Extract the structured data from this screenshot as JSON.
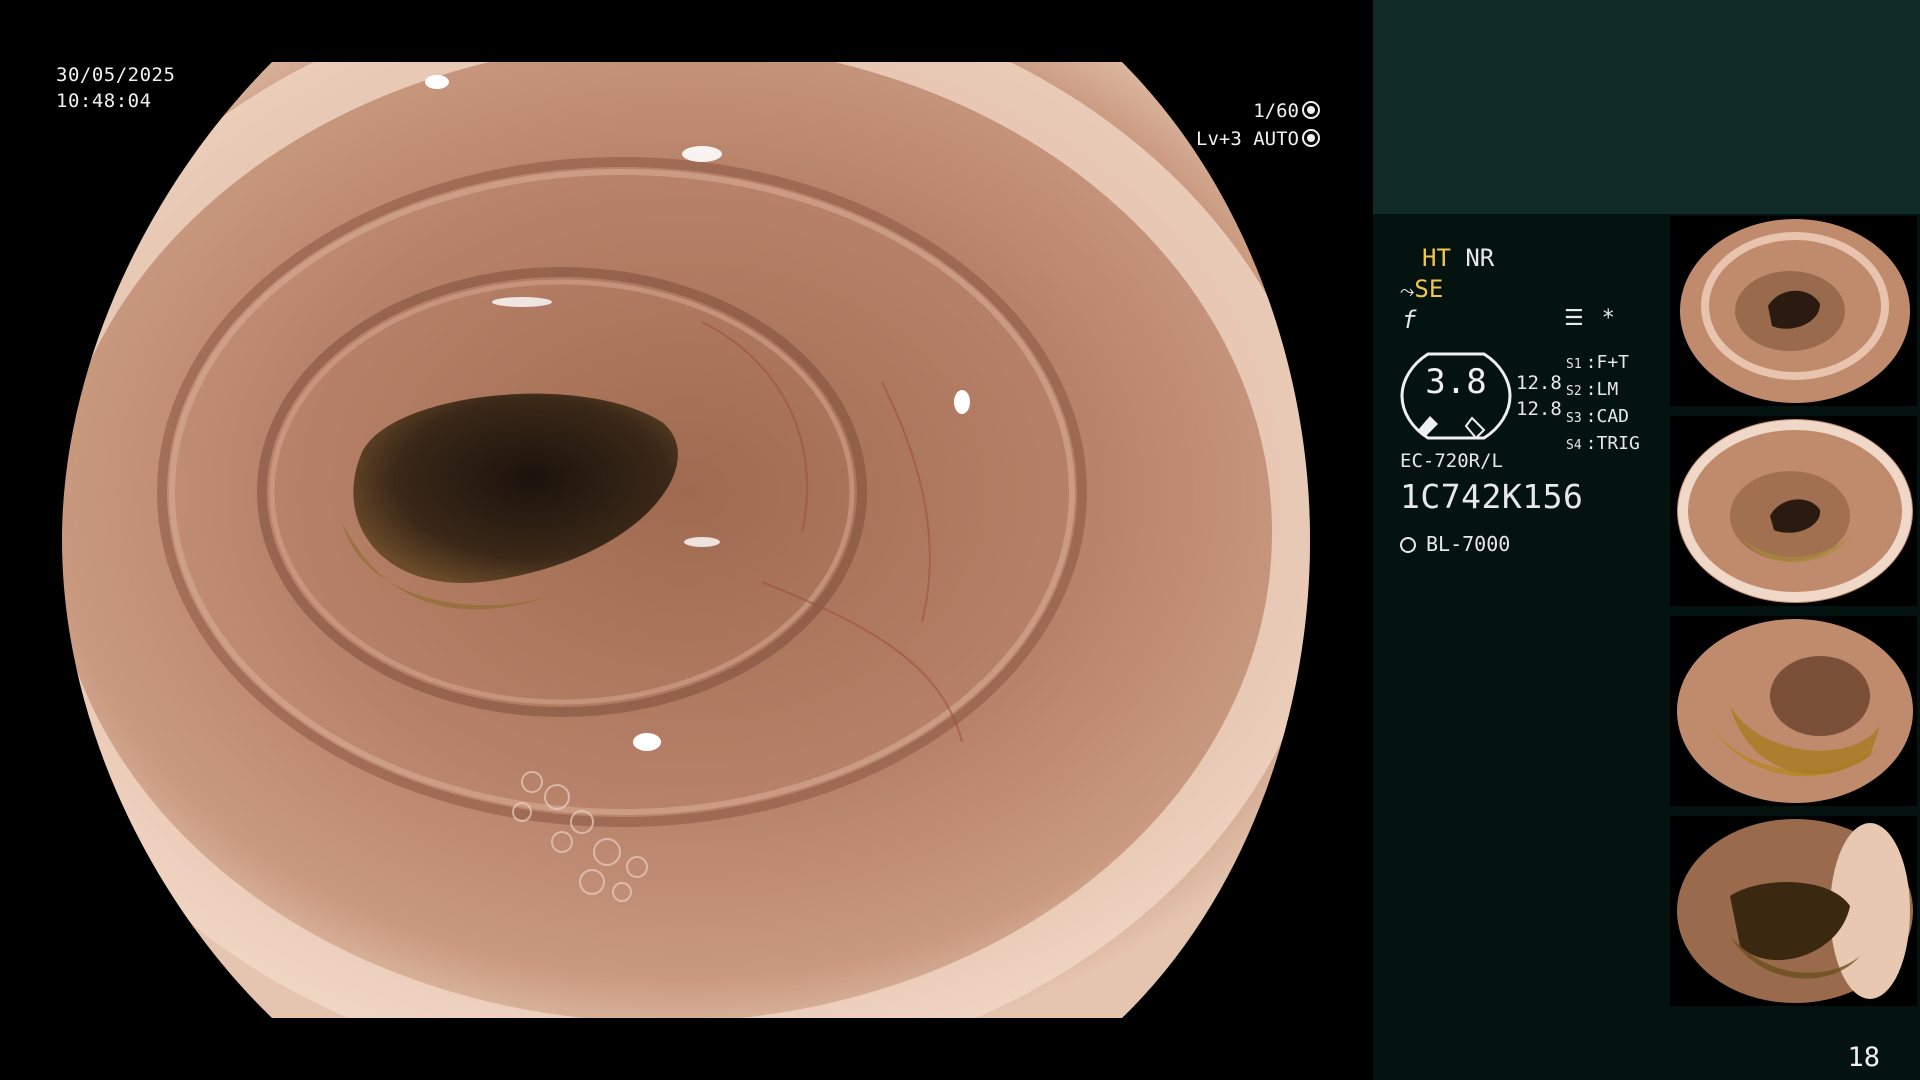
{
  "view": {
    "date": "30/05/2025",
    "time": "10:48:04",
    "shutter": "1/60",
    "level": "Lv+3",
    "mode": "AUTO"
  },
  "panel": {
    "ht": "HT",
    "nr": "NR",
    "se": "SE",
    "f_symbol": "f",
    "icon_list": "list-icon",
    "icon_star": "*",
    "dial_value": "3.8",
    "stat_1": "12.8",
    "stat_2": "12.8",
    "settings": [
      {
        "key": "S1",
        "value": "F+T"
      },
      {
        "key": "S2",
        "value": "LM"
      },
      {
        "key": "S3",
        "value": "CAD"
      },
      {
        "key": "S4",
        "value": "TRIG"
      }
    ],
    "scope_model": "EC-720R/L",
    "serial": "1C742K156",
    "light_source": "BL-7000"
  },
  "page_number": "18",
  "colors": {
    "panel_top": "#0f2a27",
    "panel_bg": "#041210",
    "highlight": "#f2c84b",
    "tissue": "#b07a5e",
    "lumen": "#2a1a10"
  }
}
